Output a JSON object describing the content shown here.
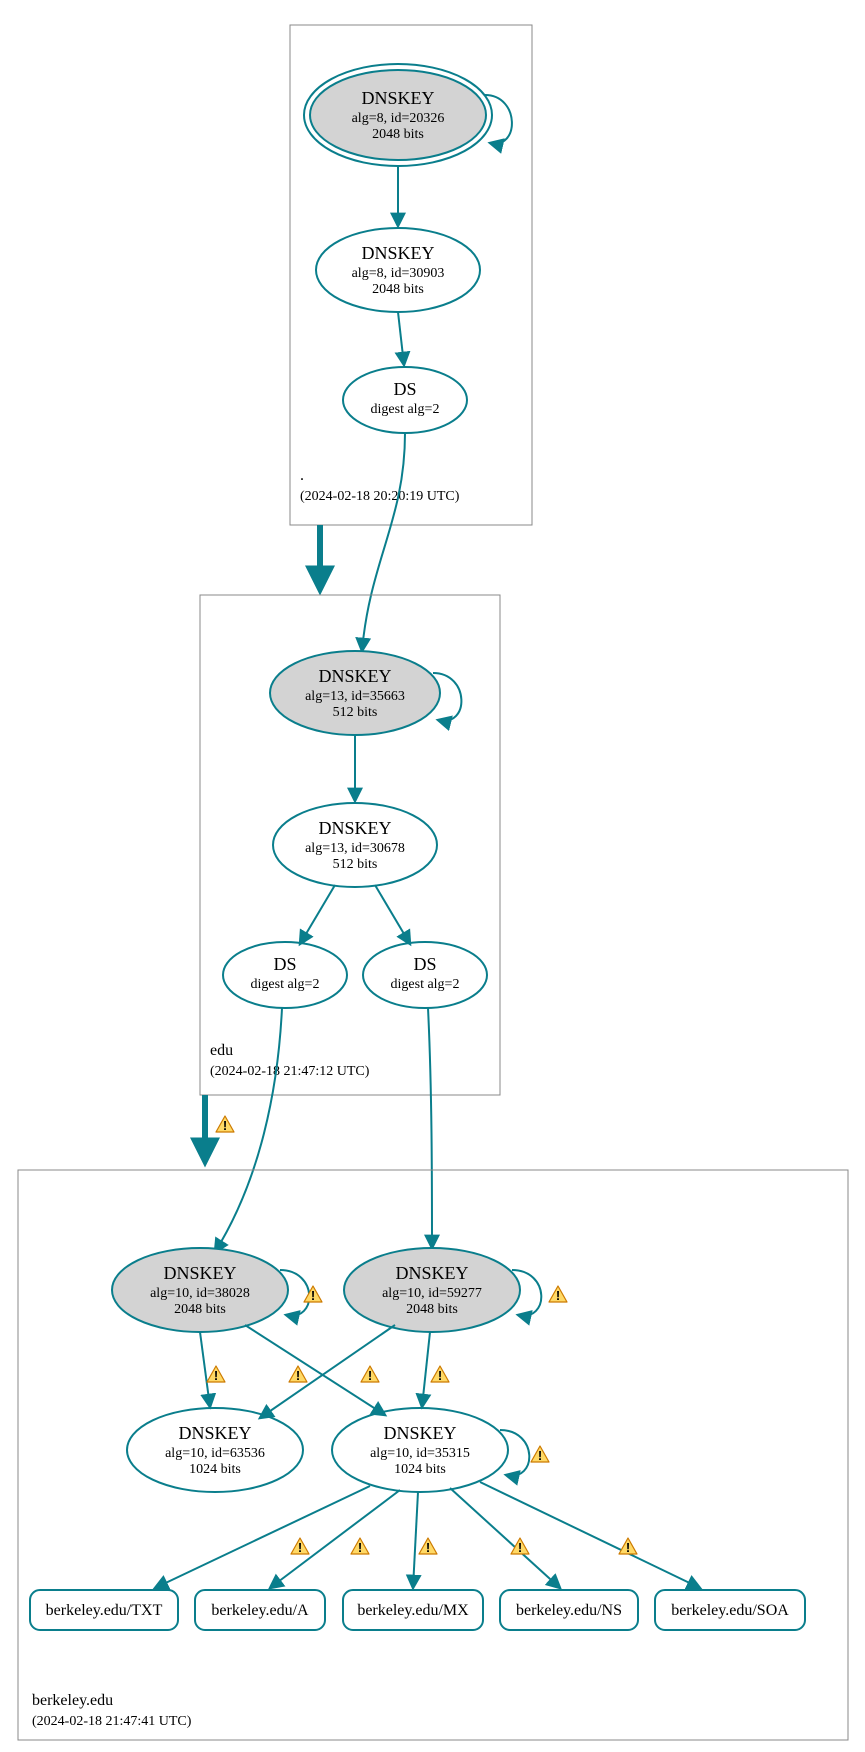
{
  "colors": {
    "edge": "#0a7e8c",
    "sep_fill": "#d3d3d3",
    "box_stroke": "#888888",
    "warn_fill": "#ffd966",
    "warn_stroke": "#cc7a00"
  },
  "zones": {
    "root": {
      "label": ".",
      "timestamp": "(2024-02-18 20:20:19 UTC)"
    },
    "edu": {
      "label": "edu",
      "timestamp": "(2024-02-18 21:47:12 UTC)"
    },
    "berkeley": {
      "label": "berkeley.edu",
      "timestamp": "(2024-02-18 21:47:41 UTC)"
    }
  },
  "nodes": {
    "root_ksk": {
      "title": "DNSKEY",
      "line2": "alg=8, id=20326",
      "line3": "2048 bits"
    },
    "root_zsk": {
      "title": "DNSKEY",
      "line2": "alg=8, id=30903",
      "line3": "2048 bits"
    },
    "root_ds": {
      "title": "DS",
      "line2": "digest alg=2"
    },
    "edu_ksk": {
      "title": "DNSKEY",
      "line2": "alg=13, id=35663",
      "line3": "512 bits"
    },
    "edu_zsk": {
      "title": "DNSKEY",
      "line2": "alg=13, id=30678",
      "line3": "512 bits"
    },
    "edu_ds1": {
      "title": "DS",
      "line2": "digest alg=2"
    },
    "edu_ds2": {
      "title": "DS",
      "line2": "digest alg=2"
    },
    "bk_ksk1": {
      "title": "DNSKEY",
      "line2": "alg=10, id=38028",
      "line3": "2048 bits"
    },
    "bk_ksk2": {
      "title": "DNSKEY",
      "line2": "alg=10, id=59277",
      "line3": "2048 bits"
    },
    "bk_zsk1": {
      "title": "DNSKEY",
      "line2": "alg=10, id=63536",
      "line3": "1024 bits"
    },
    "bk_zsk2": {
      "title": "DNSKEY",
      "line2": "alg=10, id=35315",
      "line3": "1024 bits"
    },
    "rr_txt": {
      "label": "berkeley.edu/TXT"
    },
    "rr_a": {
      "label": "berkeley.edu/A"
    },
    "rr_mx": {
      "label": "berkeley.edu/MX"
    },
    "rr_ns": {
      "label": "berkeley.edu/NS"
    },
    "rr_soa": {
      "label": "berkeley.edu/SOA"
    }
  }
}
